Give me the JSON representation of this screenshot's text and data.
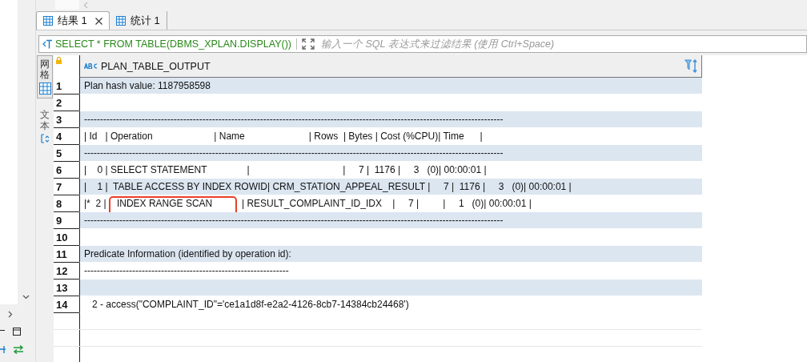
{
  "tabs": [
    {
      "label": "结果 1",
      "selected": true,
      "closable": true
    },
    {
      "label": "统计 1",
      "selected": false,
      "closable": false
    }
  ],
  "filter": {
    "query": "SELECT * FROM TABLE(DBMS_XPLAN.DISPLAY())",
    "placeholder": "输入一个 SQL 表达式来过滤结果 (使用 Ctrl+Space)"
  },
  "view_tabs": [
    {
      "label": "网格",
      "selected": true
    },
    {
      "label": "文本",
      "selected": false
    }
  ],
  "grid": {
    "columns": [
      "PLAN_TABLE_OUTPUT"
    ],
    "rows": [
      {
        "number": "1",
        "text": "Plan hash value: 1187958598",
        "marked": false
      },
      {
        "number": "2",
        "text": "",
        "marked": false
      },
      {
        "number": "3",
        "text": "-----------------------------------------------------------------------------------------------------------------------------------",
        "marked": false
      },
      {
        "number": "4",
        "text": "| Id   | Operation                       | Name                        | Rows  | Bytes | Cost (%CPU)| Time      |",
        "marked": false
      },
      {
        "number": "5",
        "text": "-----------------------------------------------------------------------------------------------------------------------------------",
        "marked": false
      },
      {
        "number": "6",
        "text": "|    0 | SELECT STATEMENT               |                                   |     7 |  1176 |     3   (0)| 00:00:01 |",
        "marked": false
      },
      {
        "number": "7",
        "text": "|    1 |  TABLE ACCESS BY INDEX ROWID| CRM_STATION_APPEAL_RESULT |     7 |  1176 |     3   (0)| 00:00:01 |",
        "marked": false
      },
      {
        "number": "8",
        "text": "|*  2 |    INDEX RANGE SCAN           | RESULT_COMPLAINT_ID_IDX    |     7 |         |     1   (0)| 00:00:01 |",
        "marked": true
      },
      {
        "number": "9",
        "text": "-----------------------------------------------------------------------------------------------------------------------------------",
        "marked": false
      },
      {
        "number": "10",
        "text": "",
        "marked": false
      },
      {
        "number": "11",
        "text": "Predicate Information (identified by operation id):",
        "marked": false
      },
      {
        "number": "12",
        "text": "----------------------------------------------------------------",
        "marked": false
      },
      {
        "number": "13",
        "text": "",
        "marked": false
      },
      {
        "number": "14",
        "text": "   2 - access(\"COMPLAINT_ID\"='ce1a1d8f-e2a2-4126-8cb7-14384cb24468')",
        "marked": false
      }
    ]
  }
}
